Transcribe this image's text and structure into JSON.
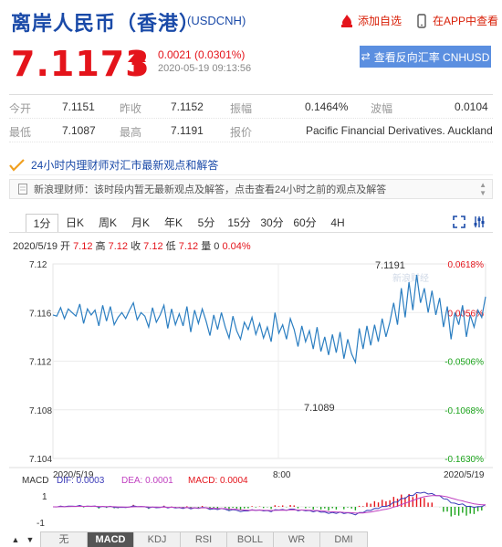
{
  "header": {
    "title": "离岸人民币（香港）",
    "code": "(USDCNH)",
    "add_watch": "添加自选",
    "open_app": "在APP中查看"
  },
  "quote": {
    "price": "7.1173",
    "change": "0.0021 (0.0301%)",
    "time": "2020-05-19 09:13:56",
    "reverse_button": "查看反向汇率 CNHUSD"
  },
  "stats": {
    "open_label": "今开",
    "open": "7.1151",
    "prev_label": "昨收",
    "prev": "7.1152",
    "amp_label": "振幅",
    "amp": "0.1464%",
    "vol_label": "波幅",
    "vol": "0.0104",
    "low_label": "最低",
    "low": "7.1087",
    "high_label": "最高",
    "high": "7.1191",
    "src_label": "报价",
    "src": "Pacific Financial Derivatives. Auckland"
  },
  "news": {
    "heading": "24小时内理财师对汇市最新观点和解答",
    "text": "新浪理财师：该时段内暂无最新观点及解答，点击查看24小时之前的观点及解答"
  },
  "tabs": [
    "1分",
    "日K",
    "周K",
    "月K",
    "年K",
    "5分",
    "15分",
    "30分",
    "60分",
    "4H"
  ],
  "info": {
    "date": "2020/5/19",
    "open_label": "开",
    "open": "7.12",
    "high_label": "高",
    "high": "7.12",
    "close_label": "收",
    "close": "7.12",
    "low_label": "低",
    "low": "7.12",
    "vol_label": "量",
    "vol": "0",
    "pct": "0.04%"
  },
  "chart": {
    "watermark": "新浪财经",
    "annot_high": "7.1191",
    "annot_low": "7.1089",
    "x_start": "2020/5/19",
    "x_mid": "8:00",
    "x_end": "2020/5/19",
    "macd_label": "MACD",
    "dif": "DIF: 0.0003",
    "dea": "DEA: 0.0001",
    "macd": "MACD: 0.0004",
    "macd_ticks": [
      "1",
      "-1"
    ]
  },
  "chart_data": {
    "type": "line",
    "y_ticks_left": [
      "7.12",
      "7.116",
      "7.112",
      "7.108",
      "7.104"
    ],
    "y_ticks_right": [
      "0.0618%",
      "0.0056%",
      "-0.0506%",
      "-0.1068%",
      "-0.1630%"
    ],
    "ylim": [
      7.104,
      7.12
    ],
    "x_labels": [
      "2020/5/19",
      "8:00",
      "2020/5/19"
    ],
    "series": [
      {
        "values": [
          7.1158,
          7.1157,
          7.1164,
          7.1155,
          7.1163,
          7.116,
          7.1157,
          7.1167,
          7.1151,
          7.1163,
          7.1158,
          7.1162,
          7.1149,
          7.1166,
          7.1153,
          7.1165,
          7.115,
          7.1156,
          7.116,
          7.1155,
          7.1162,
          7.1168,
          7.1154,
          7.116,
          7.1157,
          7.1148,
          7.1164,
          7.1152,
          7.1158,
          7.1166,
          7.1147,
          7.1163,
          7.115,
          7.1159,
          7.1149,
          7.1165,
          7.1144,
          7.1162,
          7.1151,
          7.1163,
          7.1153,
          7.1141,
          7.1158,
          7.1146,
          7.116,
          7.1148,
          7.1139,
          7.1157,
          7.1145,
          7.1138,
          7.1152,
          7.1146,
          7.1156,
          7.1142,
          7.1151,
          7.1139,
          7.1148,
          7.1136,
          7.116,
          7.1143,
          7.115,
          7.1138,
          7.1155,
          7.1146,
          7.1132,
          7.1149,
          7.1136,
          7.1145,
          7.113,
          7.1148,
          7.1128,
          7.114,
          7.1125,
          7.1142,
          7.1127,
          7.1144,
          7.1122,
          7.1138,
          7.1126,
          7.1119,
          7.1147,
          7.113,
          7.1149,
          7.1133,
          7.115,
          7.1136,
          7.1155,
          7.114,
          7.1152,
          7.1168,
          7.115,
          7.118,
          7.1156,
          7.1185,
          7.1162,
          7.1191,
          7.1168,
          7.118,
          7.116,
          7.1178,
          7.1158,
          7.1172,
          7.1148,
          7.1165,
          7.1138,
          7.116,
          7.115,
          7.1166,
          7.114,
          7.1158,
          7.1148,
          7.1162,
          7.1156,
          7.1173
        ]
      }
    ]
  },
  "bottom_tabs": [
    "无",
    "MACD",
    "KDJ",
    "RSI",
    "BOLL",
    "WR",
    "DMI"
  ],
  "colors": {
    "brand_blue": "#1a4aa8",
    "up_red": "#e4141b",
    "down_green": "#1ba41b",
    "line": "#2b7ec1"
  }
}
